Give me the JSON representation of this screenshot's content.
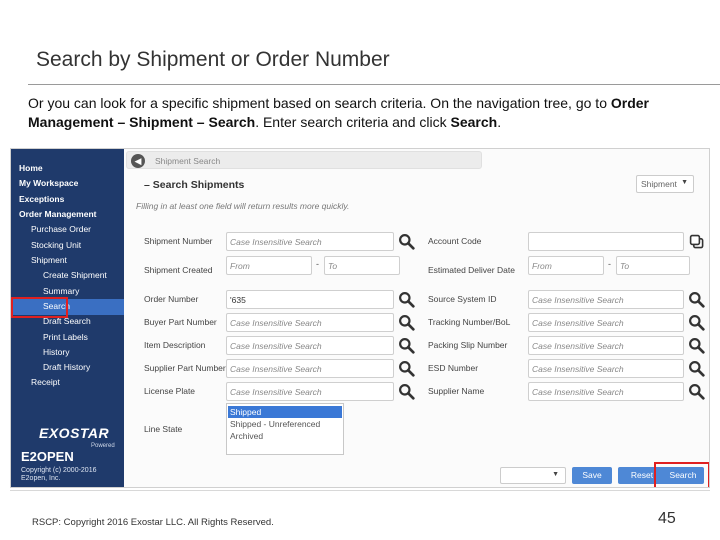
{
  "slide": {
    "title": "Search by Shipment or Order Number",
    "intro_plain_1": "Or you can look for a specific shipment based on search criteria.  On the navigation tree, go to",
    "intro_bold_path": "Order Management – Shipment – Search",
    "intro_plain_2": ".  Enter search criteria and click ",
    "intro_bold_action": "Search",
    "intro_end": "."
  },
  "nav": {
    "items": [
      "Home",
      "My Workspace",
      "Exceptions",
      "Order Management",
      "Purchase Order",
      "Stocking Unit",
      "Shipment",
      "Create Shipment",
      "Summary",
      "Search",
      "Draft Search",
      "Print Labels",
      "History",
      "Draft History",
      "Receipt"
    ],
    "logo_primary": "EXOSTAR",
    "logo_powered": "Powered",
    "logo_secondary": "E2OPEN",
    "copyright_1": "Copyright (c) 2000-2016",
    "copyright_2": "E2open, Inc."
  },
  "page": {
    "breadcrumb": "Shipment Search",
    "section_title": "– Search Shipments",
    "hint": "Filling in at least one field will return results more quickly.",
    "type_select": "Shipment"
  },
  "form": {
    "left_labels": [
      "Shipment Number",
      "Shipment Created",
      "Order Number",
      "Buyer Part Number",
      "Item Description",
      "Supplier Part Number",
      "License Plate",
      "Line State"
    ],
    "right_labels": [
      "Account Code",
      "Estimated Deliver Date",
      "Source System ID",
      "Tracking Number/BoL",
      "Packing Slip Number",
      "ESD Number",
      "Supplier Name"
    ],
    "placeholder": "Case Insensitive Search",
    "from": "From",
    "to": "To",
    "order_number_value": "'635",
    "line_states": [
      "Shipped",
      "Shipped - Unreferenced",
      "Archived"
    ]
  },
  "buttons": {
    "save": "Save",
    "reset": "Reset",
    "search": "Search"
  },
  "footer": {
    "copyright": "RSCP:  Copyright 2016 Exostar LLC. All Rights Reserved.",
    "page_number": "45"
  },
  "colors": {
    "nav_bg": "#1f3a6b",
    "button_blue": "#4e88d6",
    "highlight_red": "#e02020"
  }
}
